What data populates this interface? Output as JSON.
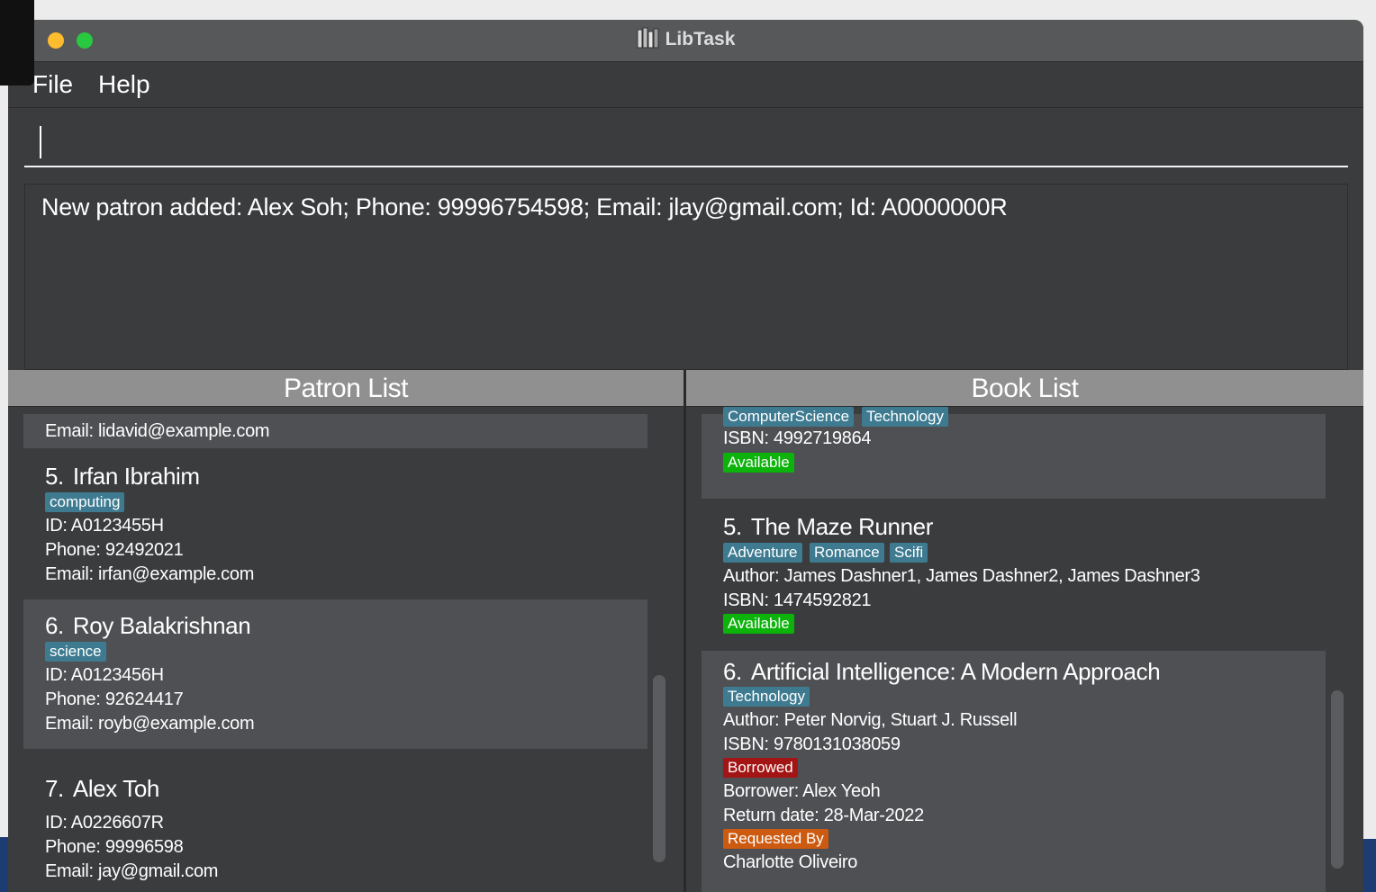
{
  "window": {
    "title": "LibTask"
  },
  "menu": {
    "file": "File",
    "help": "Help"
  },
  "command": {
    "value": ""
  },
  "result": {
    "text": "New patron added: Alex Soh; Phone: 99996754598; Email: jlay@gmail.com; Id: A0000000R"
  },
  "patron_list": {
    "header": "Patron List",
    "partial_top": {
      "email": "Email: lidavid@example.com"
    },
    "items": [
      {
        "index": "5.",
        "name": "Irfan Ibrahim",
        "tags": [
          "computing"
        ],
        "id": "ID: A0123455H",
        "phone": "Phone: 92492021",
        "email": "Email: irfan@example.com"
      },
      {
        "index": "6.",
        "name": "Roy Balakrishnan",
        "tags": [
          "science"
        ],
        "id": "ID: A0123456H",
        "phone": "Phone: 92624417",
        "email": "Email: royb@example.com"
      },
      {
        "index": "7.",
        "name": "Alex Toh",
        "tags": [],
        "id": "ID: A0226607R",
        "phone": "Phone: 99996598",
        "email": "Email: jay@gmail.com"
      }
    ]
  },
  "book_list": {
    "header": "Book List",
    "partial_top": {
      "tags": [
        "ComputerScience",
        "Technology"
      ],
      "isbn": "ISBN: 4992719864",
      "status": "Available"
    },
    "items": [
      {
        "index": "5.",
        "title": "The Maze Runner",
        "tags": [
          "Adventure",
          "Romance",
          "Scifi"
        ],
        "author": "Author: James Dashner1, James Dashner2, James Dashner3",
        "isbn": "ISBN: 1474592821",
        "status": "Available"
      },
      {
        "index": "6.",
        "title": "Artificial Intelligence: A Modern Approach",
        "tags": [
          "Technology"
        ],
        "author": "Author: Peter Norvig, Stuart J. Russell",
        "isbn": "ISBN: 9780131038059",
        "status": "Borrowed",
        "borrower": "Borrower: Alex Yeoh",
        "return_date": "Return date: 28-Mar-2022",
        "requested_label": "Requested By",
        "requested_by": "Charlotte Oliveiro"
      }
    ]
  },
  "colors": {
    "tag": "#3e7b91",
    "available": "#0bb30b",
    "borrowed": "#a31414",
    "requested": "#cc5a10"
  }
}
